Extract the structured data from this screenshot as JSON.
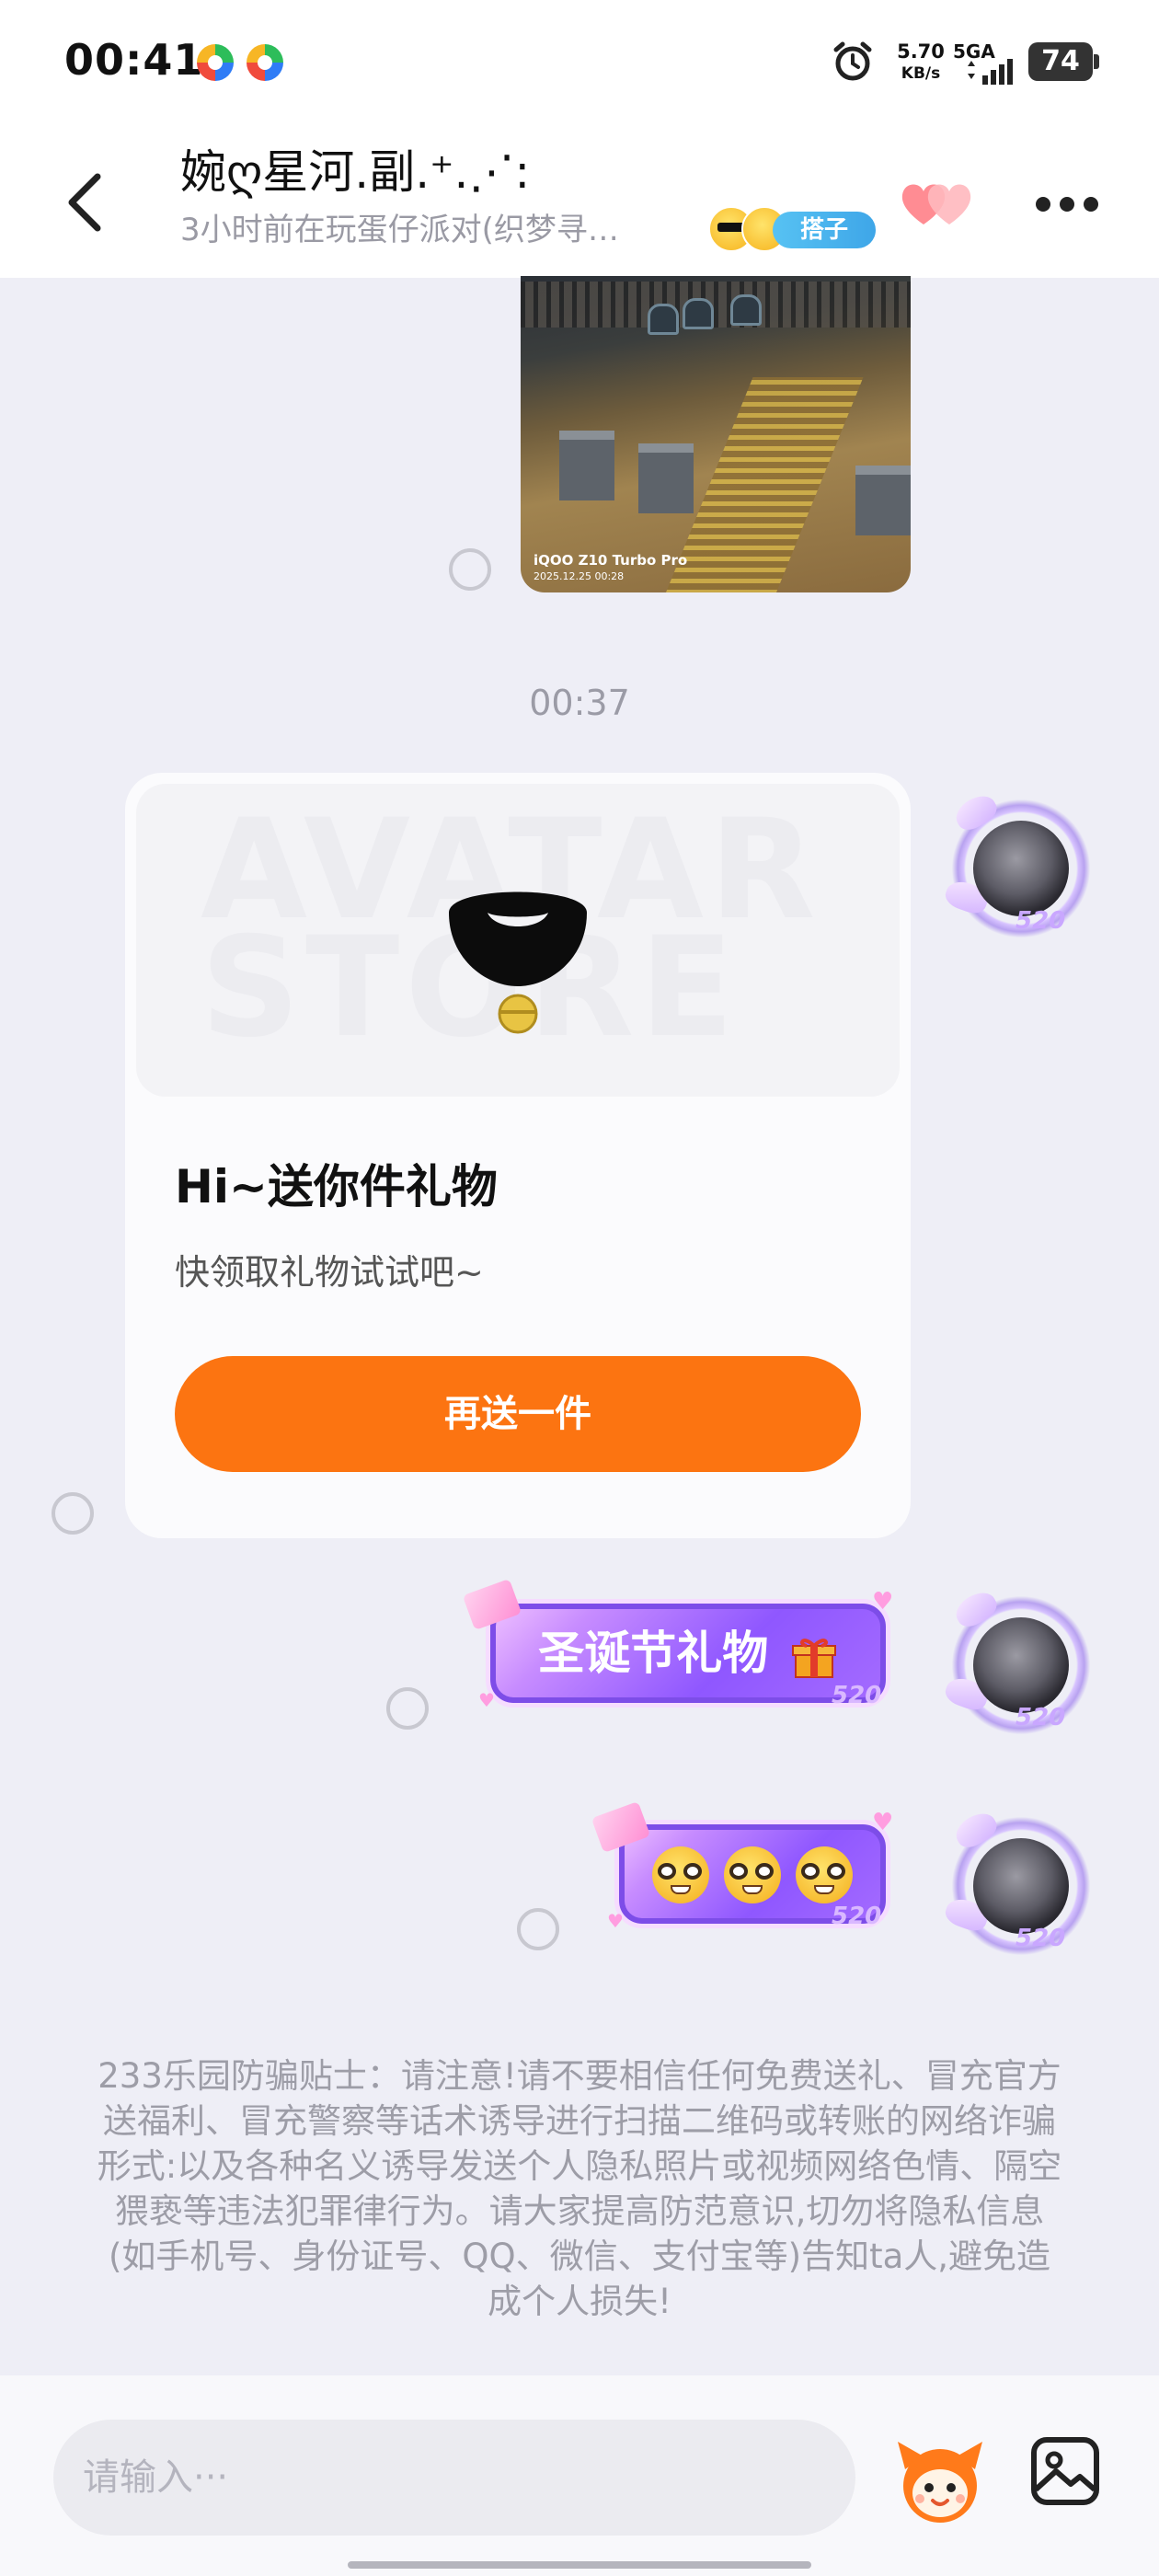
{
  "status_bar": {
    "time": "00:41",
    "net_speed_value": "5.70",
    "net_speed_unit": "KB/s",
    "network_type": "5GA",
    "battery": "74"
  },
  "header": {
    "name": "婉ღ星河.副.⁺.⋰:",
    "status": "3小时前在玩蛋仔派对(织梦寻…",
    "tag": "搭子"
  },
  "chat": {
    "photo_watermark_model": "iQOO Z10 Turbo Pro",
    "photo_watermark_date": "2025.12.25 00:28",
    "time_separator": "00:37",
    "gift_card": {
      "art_watermark": "AVATAR STORE",
      "title": "Hi~送你件礼物",
      "subtitle": "快领取礼物试试吧~",
      "button_label": "再送一件"
    },
    "message_christmas_gift": "圣诞节礼物",
    "bubble_badge": "520"
  },
  "fraud_tip": "233乐园防骗贴士：请注意!请不要相信任何免费送礼、冒充官方送福利、冒充警察等话术诱导进行扫描二维码或转账的网络诈骗形式:以及各种名义诱导发送个人隐私照片或视频网络色情、隔空猥亵等违法犯罪律行为。请大家提高防范意识,切勿将隐私信息(如手机号、身份证号、QQ、微信、支付宝等)告知ta人,避免造成个人损失!",
  "input": {
    "placeholder": "请输入···"
  },
  "colors": {
    "accent_orange": "#fc7411",
    "bubble_purple": "#8f57ff",
    "tag_blue": "#3ea6e8"
  }
}
